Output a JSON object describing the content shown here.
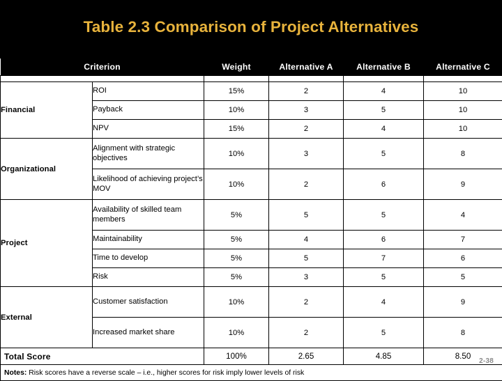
{
  "slide": {
    "title": "Table 2.3  Comparison of Project Alternatives",
    "title_color": "#E8B33C",
    "background_color": "#000000",
    "page_number": "2-38"
  },
  "table": {
    "headers": {
      "criterion": "Criterion",
      "weight": "Weight",
      "alt_a": "Alternative A",
      "alt_b": "Alternative B",
      "alt_c": "Alternative C"
    },
    "groups": [
      {
        "category": "Financial",
        "rows": [
          {
            "criterion": "ROI",
            "weight": "15%",
            "alt_a": "2",
            "alt_b": "4",
            "alt_c": "10"
          },
          {
            "criterion": "Payback",
            "weight": "10%",
            "alt_a": "3",
            "alt_b": "5",
            "alt_c": "10"
          },
          {
            "criterion": "NPV",
            "weight": "15%",
            "alt_a": "2",
            "alt_b": "4",
            "alt_c": "10"
          }
        ]
      },
      {
        "category": "Organizational",
        "rows": [
          {
            "criterion": "Alignment with strategic objectives",
            "weight": "10%",
            "alt_a": "3",
            "alt_b": "5",
            "alt_c": "8"
          },
          {
            "criterion": "Likelihood of achieving project’s MOV",
            "weight": "10%",
            "alt_a": "2",
            "alt_b": "6",
            "alt_c": "9"
          }
        ]
      },
      {
        "category": "Project",
        "rows": [
          {
            "criterion": "Availability of skilled team members",
            "weight": "5%",
            "alt_a": "5",
            "alt_b": "5",
            "alt_c": "4"
          },
          {
            "criterion": "Maintainability",
            "weight": "5%",
            "alt_a": "4",
            "alt_b": "6",
            "alt_c": "7"
          },
          {
            "criterion": "Time to develop",
            "weight": "5%",
            "alt_a": "5",
            "alt_b": "7",
            "alt_c": "6"
          },
          {
            "criterion": "Risk",
            "weight": "5%",
            "alt_a": "3",
            "alt_b": "5",
            "alt_c": "5"
          }
        ]
      },
      {
        "category": "External",
        "rows": [
          {
            "criterion": "Customer satisfaction",
            "weight": "10%",
            "alt_a": "2",
            "alt_b": "4",
            "alt_c": "9"
          },
          {
            "criterion": "Increased market share",
            "weight": "10%",
            "alt_a": "2",
            "alt_b": "5",
            "alt_c": "8"
          }
        ]
      }
    ],
    "total": {
      "label": "Total Score",
      "weight": "100%",
      "alt_a": "2.65",
      "alt_b": "4.85",
      "alt_c": "8.50"
    },
    "notes": {
      "label": "Notes:",
      "text": " Risk scores have a reverse scale – i.e., higher scores for risk imply lower levels of risk"
    }
  }
}
